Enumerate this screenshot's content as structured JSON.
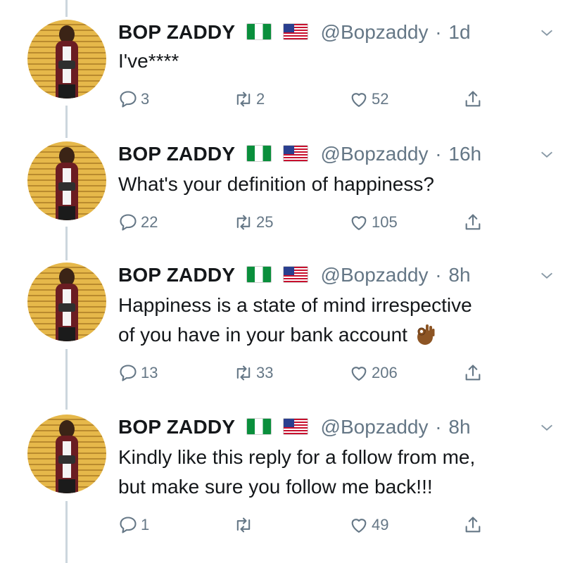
{
  "tweets": [
    {
      "name": "BOP ZADDY",
      "handle": "@Bopzaddy",
      "separator": "·",
      "time": "1d",
      "text_lines": [
        "I've****"
      ],
      "reply_count": "3",
      "retweet_count": "2",
      "like_count": "52"
    },
    {
      "name": "BOP ZADDY",
      "handle": "@Bopzaddy",
      "separator": "·",
      "time": "16h",
      "text_lines": [
        "What's your definition of happiness?"
      ],
      "reply_count": "22",
      "retweet_count": "25",
      "like_count": "105"
    },
    {
      "name": "BOP ZADDY",
      "handle": "@Bopzaddy",
      "separator": "·",
      "time": "8h",
      "text_lines": [
        "Happiness is a state of mind irrespective",
        "of you have in your bank account"
      ],
      "emoji": "ok-hand-emoji",
      "reply_count": "13",
      "retweet_count": "33",
      "like_count": "206"
    },
    {
      "name": "BOP ZADDY",
      "handle": "@Bopzaddy",
      "separator": "·",
      "time": "8h",
      "text_lines": [
        "Kindly like this reply for a follow from me,",
        "but make sure you follow me back!!!"
      ],
      "reply_count": "1",
      "retweet_count": "",
      "like_count": "49"
    }
  ],
  "icons": {
    "reply": "reply-icon",
    "retweet": "retweet-icon",
    "like": "heart-icon",
    "share": "share-icon",
    "caret": "chevron-down-icon",
    "flags": [
      "nigeria-flag-icon",
      "usa-flag-icon"
    ]
  },
  "colors": {
    "text": "#14171a",
    "secondary": "#657786",
    "thread_line": "#ccd6dd"
  }
}
